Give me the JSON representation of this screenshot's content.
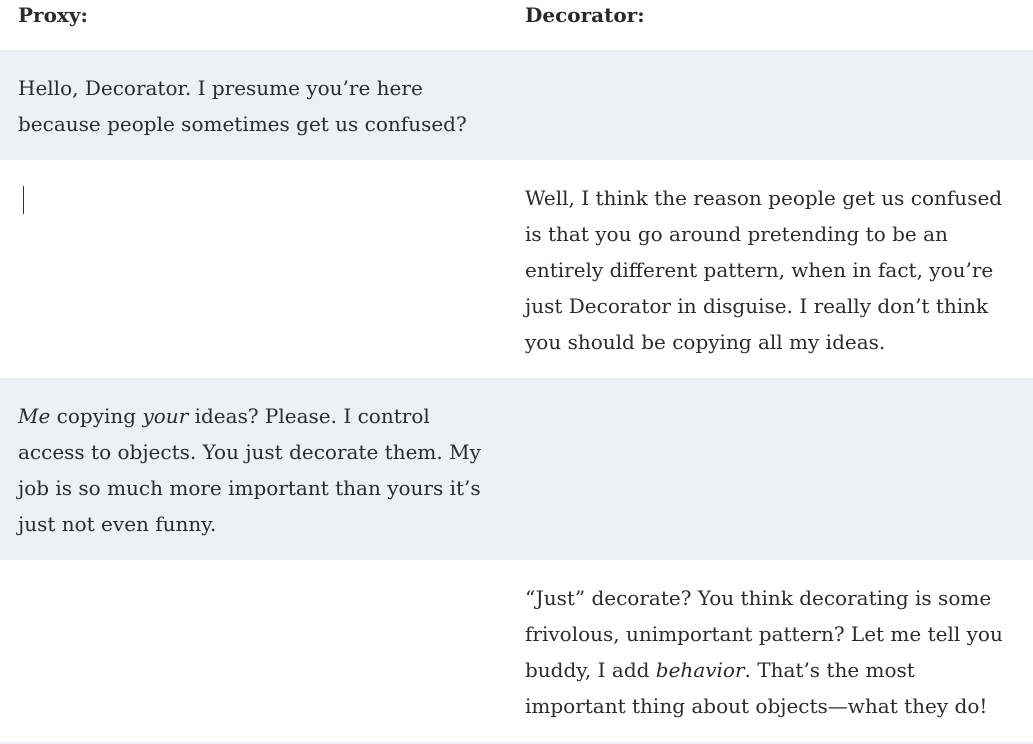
{
  "headers": {
    "proxy": "Proxy:",
    "decorator": "Decorator:"
  },
  "rows": [
    {
      "proxy": "Hello, Decorator. I presume you’re here because people sometimes get us confused?",
      "decorator": ""
    },
    {
      "proxy": "",
      "decorator": "Well, I think the reason people get us confused is that you go around pretending to be an entirely different pattern, when in fact, you’re just Decorator in disguise. I really don’t think you should be copying all my ideas."
    },
    {
      "proxy_parts": {
        "em1": "Me",
        "t1": " copying ",
        "em2": "your",
        "t2": " ideas? Please. I control access to objects. You just decorate them. My job is so much more important than yours it’s just not even funny."
      },
      "decorator": ""
    },
    {
      "proxy": "",
      "decorator_parts": {
        "t1": "“Just” decorate? You think decorating is some frivolous, unimportant pattern? Let me tell you buddy, I add ",
        "em1": "behavior",
        "t2": ". That’s the most important thing about objects—what they do!"
      }
    }
  ]
}
